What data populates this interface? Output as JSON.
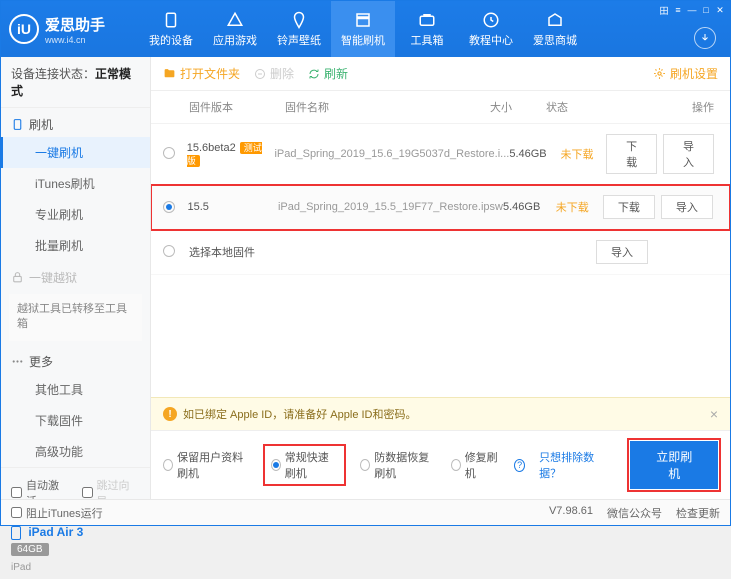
{
  "brand": {
    "name": "爱思助手",
    "url": "www.i4.cn",
    "logo_letter": "iU"
  },
  "window_buttons": [
    "田",
    "≡",
    "—",
    "□",
    "✕"
  ],
  "topnav": [
    {
      "label": "我的设备"
    },
    {
      "label": "应用游戏"
    },
    {
      "label": "铃声壁纸"
    },
    {
      "label": "智能刷机",
      "active": true
    },
    {
      "label": "工具箱"
    },
    {
      "label": "教程中心"
    },
    {
      "label": "爱思商城"
    }
  ],
  "conn": {
    "label": "设备连接状态：",
    "value": "正常模式"
  },
  "sidebar": {
    "flash_section": "刷机",
    "flash_items": [
      {
        "label": "一键刷机",
        "active": true
      },
      {
        "label": "iTunes刷机"
      },
      {
        "label": "专业刷机"
      },
      {
        "label": "批量刷机"
      }
    ],
    "jailbreak_section": "一键越狱",
    "jailbreak_note": "越狱工具已转移至工具箱",
    "more_section": "更多",
    "more_items": [
      {
        "label": "其他工具"
      },
      {
        "label": "下载固件"
      },
      {
        "label": "高级功能"
      }
    ],
    "auto_activate": "自动激活",
    "skip_guide": "跳过向导"
  },
  "device": {
    "name": "iPad Air 3",
    "capacity": "64GB",
    "model": "iPad"
  },
  "toolbar": {
    "open": "打开文件夹",
    "delete": "删除",
    "refresh": "刷新",
    "settings": "刷机设置"
  },
  "table": {
    "headers": {
      "version": "固件版本",
      "name": "固件名称",
      "size": "大小",
      "status": "状态",
      "ops": "操作"
    },
    "rows": [
      {
        "selected": false,
        "version": "15.6beta2",
        "tag": "测试版",
        "name": "iPad_Spring_2019_15.6_19G5037d_Restore.i...",
        "size": "5.46GB",
        "status": "未下载",
        "highlight": false
      },
      {
        "selected": true,
        "version": "15.5",
        "tag": "",
        "name": "iPad_Spring_2019_15.5_19F77_Restore.ipsw",
        "size": "5.46GB",
        "status": "未下载",
        "highlight": true
      }
    ],
    "local_row": "选择本地固件",
    "btn_download": "下载",
    "btn_import": "导入"
  },
  "notice": "如已绑定 Apple ID，请准备好 Apple ID和密码。",
  "flash": {
    "opts": [
      {
        "label": "保留用户资料刷机"
      },
      {
        "label": "常规快速刷机",
        "selected": true,
        "boxed": true
      },
      {
        "label": "防数据恢复刷机"
      },
      {
        "label": "修复刷机"
      }
    ],
    "exclude": "只想排除数据？",
    "action": "立即刷机"
  },
  "statusbar": {
    "block_itunes": "阻止iTunes运行",
    "version": "V7.98.61",
    "wechat": "微信公众号",
    "check": "检查更新"
  }
}
